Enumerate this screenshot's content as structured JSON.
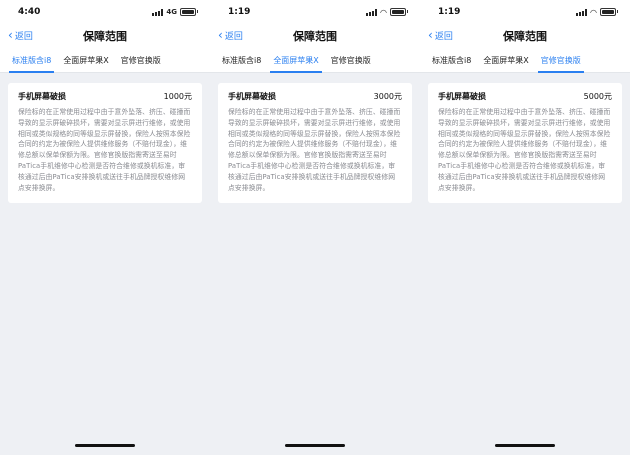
{
  "phones": [
    {
      "status": {
        "time": "4:40",
        "network": "4G"
      },
      "nav": {
        "back": "返回",
        "title": "保障范围"
      },
      "tabs": [
        "标准版含i8",
        "全面屏苹果X",
        "官修官换版"
      ],
      "active_tab": 0,
      "card": {
        "title": "手机屏幕破损",
        "price": "1000元",
        "desc": "保险标的在正常使用过程中由于意外坠落、挤压、碰撞而导致的显示屏破碎损坏，需要对显示屏进行维修，或使用相同或类似规格的同等级显示屏替换，保险人按照本保险合同的约定为被保险人提供维修服务（不赔付现金），维修总额以保单保额为限。官修官换版指需寄送至易时PaTica手机维修中心检测是否符合维修或换机标准，审核通过后由PaTica安排换机或送往手机品牌授权维修网点安排换屏。"
      }
    },
    {
      "status": {
        "time": "1:19",
        "network": ""
      },
      "nav": {
        "back": "返回",
        "title": "保障范围"
      },
      "tabs": [
        "标准版含i8",
        "全面屏苹果X",
        "官修官换版"
      ],
      "active_tab": 1,
      "card": {
        "title": "手机屏幕破损",
        "price": "3000元",
        "desc": "保险标的在正常使用过程中由于意外坠落、挤压、碰撞而导致的显示屏破碎损坏，需要对显示屏进行维修，或使用相同或类似规格的同等级显示屏替换，保险人按照本保险合同的约定为被保险人提供维修服务（不赔付现金），维修总额以保单保额为限。官修官换版指需寄送至易时PaTica手机维修中心检测是否符合维修或换机标准，审核通过后由PaTica安排换机或送往手机品牌授权维修网点安排换屏。"
      }
    },
    {
      "status": {
        "time": "1:19",
        "network": ""
      },
      "nav": {
        "back": "返回",
        "title": "保障范围"
      },
      "tabs": [
        "标准版含i8",
        "全面屏苹果X",
        "官修官换版"
      ],
      "active_tab": 2,
      "card": {
        "title": "手机屏幕破损",
        "price": "5000元",
        "desc": "保险标的在正常使用过程中由于意外坠落、挤压、碰撞而导致的显示屏破碎损坏，需要对显示屏进行维修，或使用相同或类似规格的同等级显示屏替换，保险人按照本保险合同的约定为被保险人提供维修服务（不赔付现金），维修总额以保单保额为限。官修官换版指需寄送至易时PaTica手机维修中心检测是否符合维修或换机标准，审核通过后由PaTica安排换机或送往手机品牌授权维修网点安排换屏。"
      }
    }
  ],
  "colors": {
    "accent": "#2a7ff0",
    "background": "#eef0f4",
    "card": "#ffffff",
    "desc_text": "#888a90"
  },
  "icons": [
    "signal-icon",
    "wifi-icon",
    "battery-icon",
    "chevron-left-icon"
  ]
}
